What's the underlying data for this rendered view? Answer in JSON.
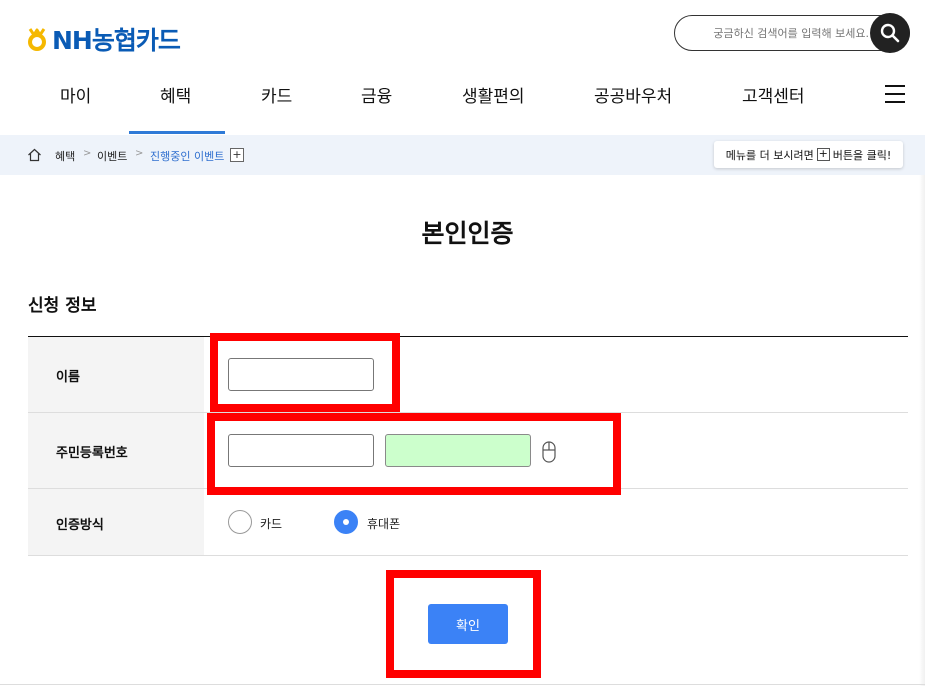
{
  "header": {
    "logo_text": "NH농협카드",
    "search_placeholder": "궁금하신 검색어를 입력해 보세요."
  },
  "nav": {
    "items": [
      "마이",
      "혜택",
      "카드",
      "금융",
      "생활편의",
      "공공바우처",
      "고객센터"
    ],
    "active": "혜택"
  },
  "breadcrumb": {
    "items": [
      "혜택",
      "이벤트",
      "진행중인 이벤트"
    ],
    "separator": ">",
    "plus": "+",
    "tip_before": "메뉴를 더 보시려면",
    "tip_plus": "+",
    "tip_after": "버튼을 클릭!"
  },
  "page": {
    "title": "본인인증",
    "section_title": "신청 정보"
  },
  "form": {
    "name_label": "이름",
    "name_value": "",
    "rrn_label": "주민등록번호",
    "rrn_front_value": "",
    "rrn_back_value": "",
    "auth_label": "인증방식",
    "auth_options": [
      "카드",
      "휴대폰"
    ],
    "auth_selected": "휴대폰"
  },
  "actions": {
    "confirm_label": "확인"
  },
  "colors": {
    "brand": "#0a5bb5",
    "logo_mark": "#f5b800",
    "accent": "#3b82f6",
    "highlight": "#ff0000",
    "rrn_back_bg": "#ccffcc"
  },
  "icons": [
    "nh-logo-icon",
    "search-icon",
    "hamburger-menu-icon",
    "home-icon",
    "mouse-icon"
  ]
}
